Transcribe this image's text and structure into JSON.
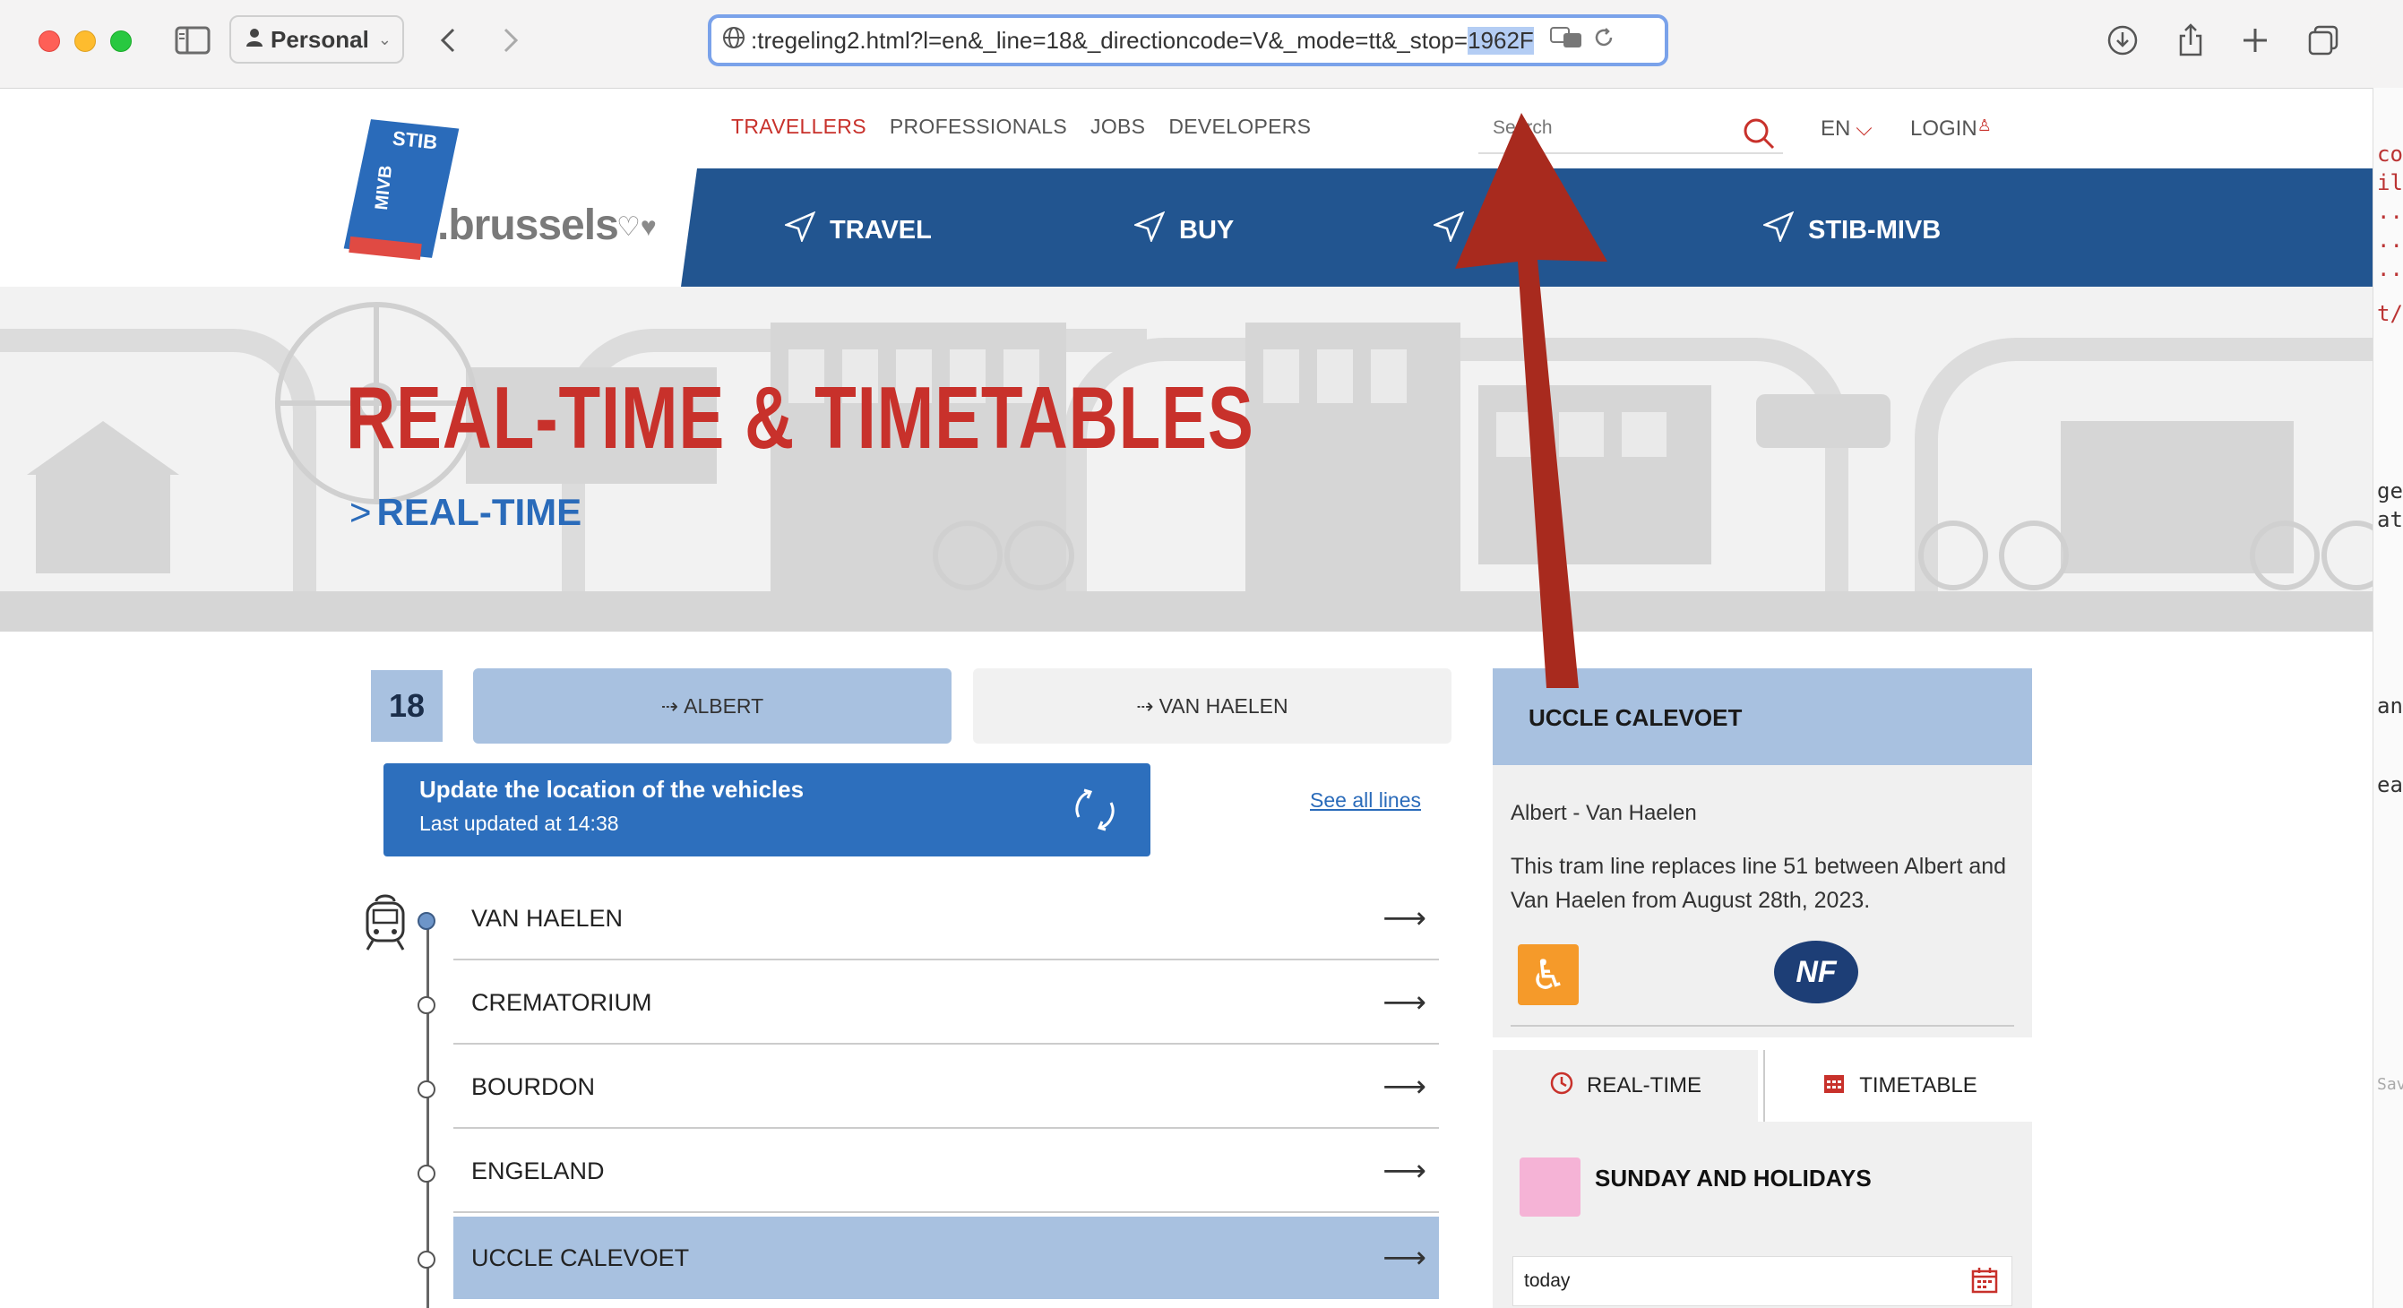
{
  "browser": {
    "profile": "Personal",
    "url_prefix": ":tregeling2.html?l=en&_line=18&_directioncode=V&_mode=tt&_stop=",
    "url_selected": "1962F"
  },
  "edge_text": [
    "co",
    "il",
    "...",
    "...",
    "...",
    "t/p",
    "ge",
    "at.",
    "ang",
    "ea",
    "Save"
  ],
  "topnav": {
    "items": [
      {
        "label": "TRAVELLERS",
        "active": true
      },
      {
        "label": "PROFESSIONALS",
        "active": false
      },
      {
        "label": "JOBS",
        "active": false
      },
      {
        "label": "DEVELOPERS",
        "active": false
      }
    ],
    "search_placeholder": "Search",
    "lang": "EN",
    "login": "LOGIN"
  },
  "logo": {
    "stib": "STIB",
    "mivb": "MIVB",
    "brussels": ".brussels"
  },
  "mainnav": {
    "items": [
      "TRAVEL",
      "BUY",
      "",
      "STIB-MIVB"
    ]
  },
  "hero": {
    "title": "REAL-TIME & TIMETABLES",
    "subtitle": "REAL-TIME"
  },
  "line": {
    "number": "18",
    "directions": [
      "ALBERT",
      "VAN HAELEN"
    ],
    "update_title": "Update the location of the vehicles",
    "update_time": "Last updated at 14:38",
    "see_all": "See all lines"
  },
  "stops": [
    "VAN HAELEN",
    "CREMATORIUM",
    "BOURDON",
    "ENGELAND",
    "UCCLE CALEVOET"
  ],
  "panel": {
    "stop_name": "UCCLE CALEVOET",
    "route": "Albert - Van Haelen",
    "description": "This tram line replaces line 51 between Albert and Van Haelen from August 28th, 2023.",
    "nf_label": "NF",
    "tabs": [
      "REAL-TIME",
      "TIMETABLE"
    ],
    "day_type": "SUNDAY AND HOLIDAYS",
    "date_value": "today"
  },
  "colors": {
    "stib_red": "#c8312b",
    "stib_blue": "#225590",
    "accent_blue": "#2d6fbd",
    "pale_blue": "#a8c1e0",
    "sunday_pink": "#f5b3d6",
    "annotation_red": "#a82a1e"
  }
}
